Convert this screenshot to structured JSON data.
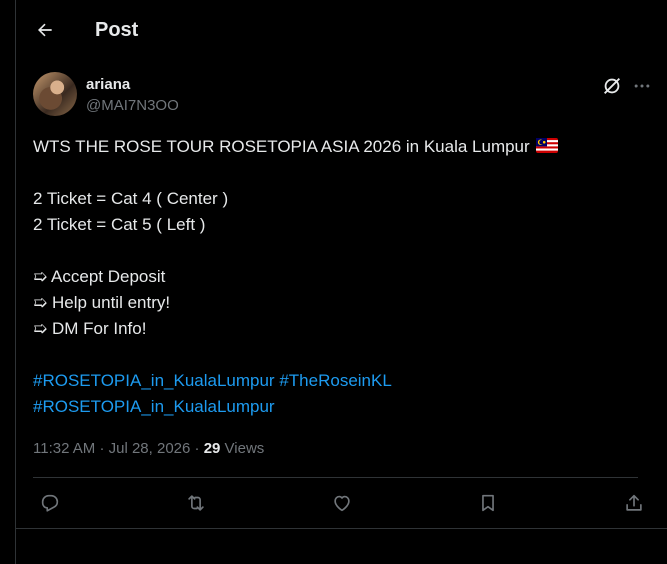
{
  "header": {
    "title": "Post",
    "back_icon": "arrow-left-icon"
  },
  "author": {
    "display_name": "ariana",
    "handle": "@MAI7N3OO"
  },
  "post": {
    "lines": [
      "WTS THE ROSE TOUR ROSETOPIA ASIA 2026 in Kuala Lumpur",
      "",
      "2 Ticket = Cat 4 ( Center )",
      "2 Ticket = Cat 5 ( Left )",
      "",
      "➯ Accept Deposit",
      "➯ Help until entry!",
      "➯ DM For Info!",
      ""
    ],
    "hashtags_line1": [
      "#ROSETOPIA_in_KualaLumpur",
      "#TheRoseinKL"
    ],
    "hashtags_line2": [
      "#ROSETOPIA_in_KualaLumpur"
    ],
    "flag": "malaysia-flag"
  },
  "meta": {
    "time": "11:32 AM",
    "date": "Jul 28, 2026",
    "views_count": "29",
    "views_label": "Views"
  },
  "colors": {
    "background": "#000000",
    "text": "#e7e9ea",
    "muted": "#71767b",
    "link": "#1d9bf0",
    "border": "#2f3336"
  },
  "actions": [
    "reply-icon",
    "repost-icon",
    "like-icon",
    "bookmark-icon",
    "share-icon"
  ]
}
